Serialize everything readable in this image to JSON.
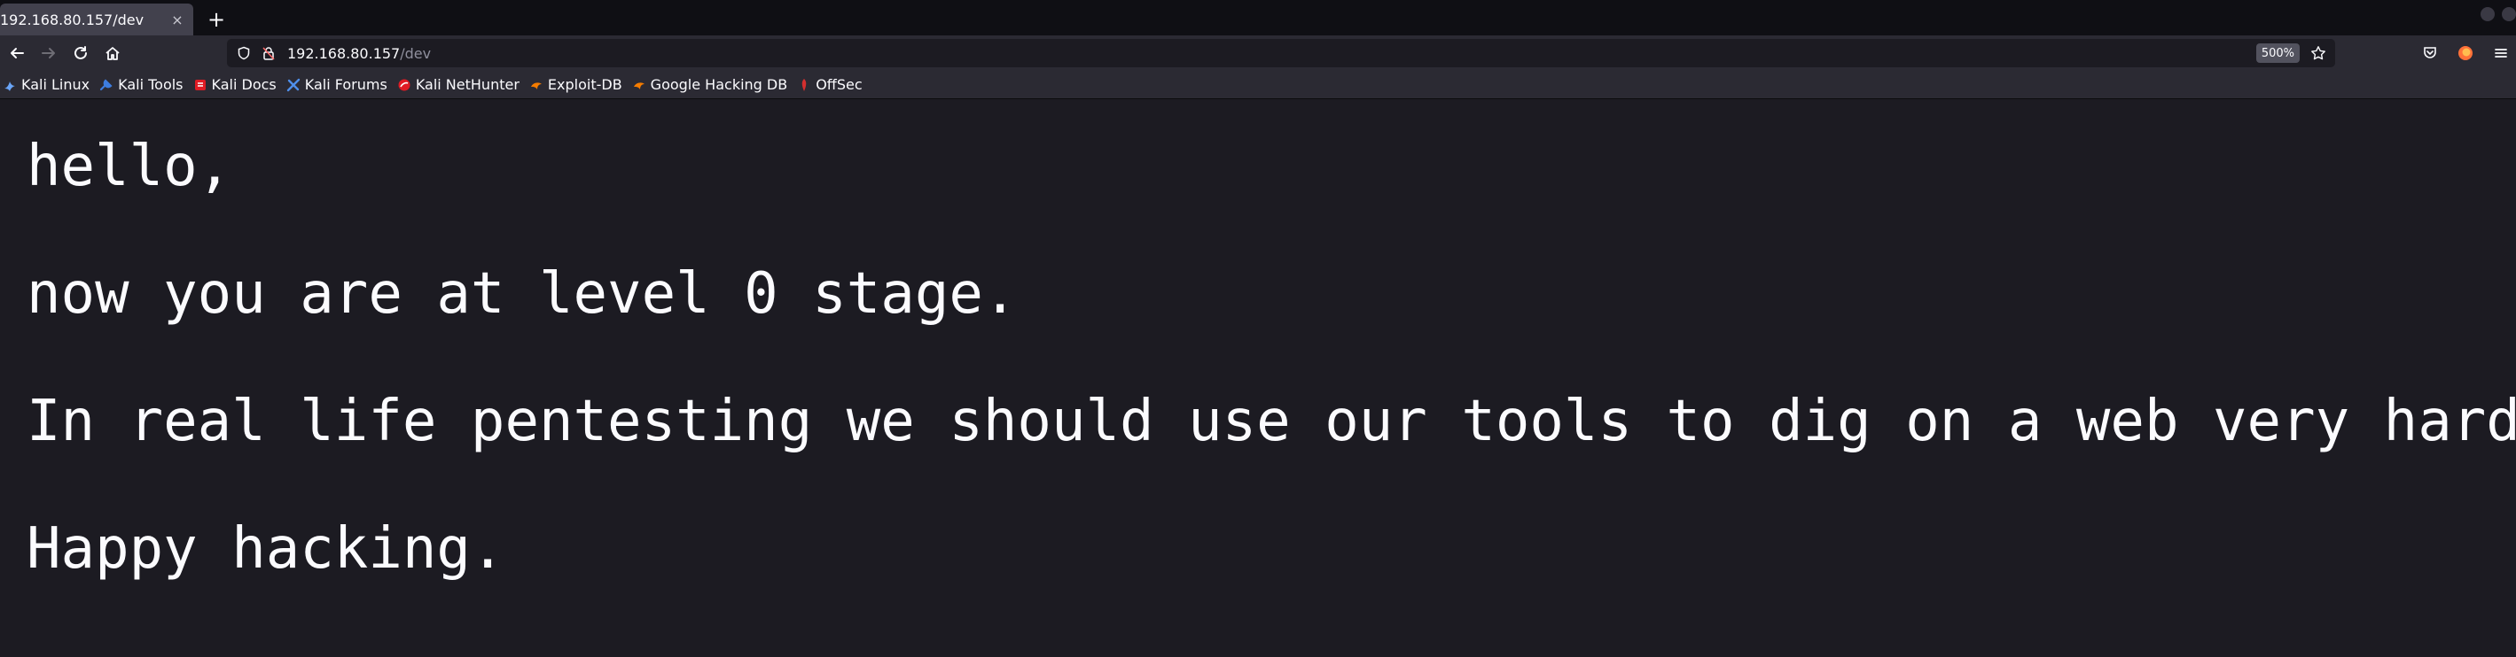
{
  "tab": {
    "title": "192.168.80.157/dev",
    "close_glyph": "×",
    "new_tab_glyph": "+"
  },
  "url": {
    "host": "192.168.80.157",
    "path": "/dev",
    "zoom": "500%"
  },
  "bookmarks": [
    {
      "label": "Kali Linux",
      "icon": "kali-dragon-icon",
      "color": "#6aa5f8"
    },
    {
      "label": "Kali Tools",
      "icon": "kali-tools-icon",
      "color": "#3d7de0"
    },
    {
      "label": "Kali Docs",
      "icon": "kali-docs-icon",
      "color": "#e01b24"
    },
    {
      "label": "Kali Forums",
      "icon": "kali-forums-icon",
      "color": "#4f8fea"
    },
    {
      "label": "Kali NetHunter",
      "icon": "nethunter-icon",
      "color": "#e01b24"
    },
    {
      "label": "Exploit-DB",
      "icon": "exploit-db-icon",
      "color": "#f57c00"
    },
    {
      "label": "Google Hacking DB",
      "icon": "ghdb-icon",
      "color": "#f57c00"
    },
    {
      "label": "OffSec",
      "icon": "offsec-icon",
      "color": "#d32f2f"
    }
  ],
  "page": {
    "line1": "hello,",
    "line2": "now you are at level 0 stage.",
    "line3": "In real life pentesting we should use our tools to dig on a web very hard.",
    "line4": "Happy hacking."
  }
}
